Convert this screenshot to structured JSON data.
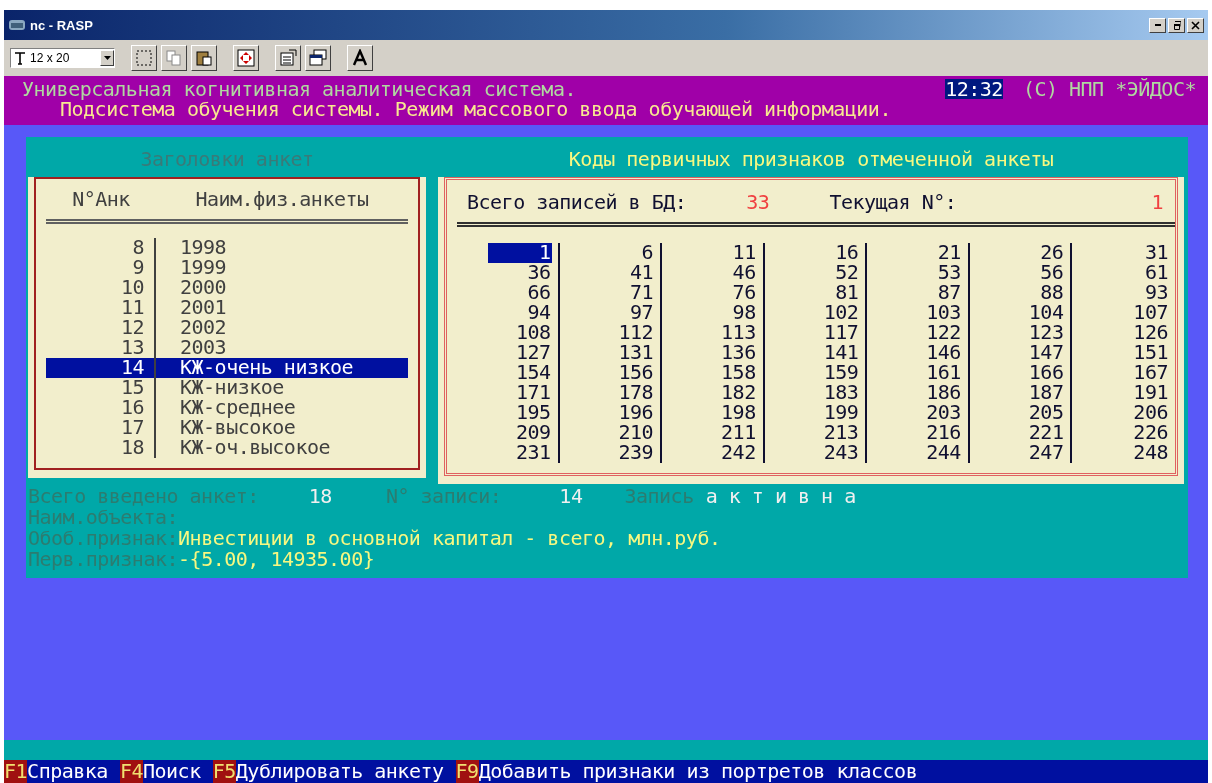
{
  "window": {
    "title": "nc - RASP"
  },
  "toolbar": {
    "font_size": "12 x 20"
  },
  "header": {
    "line1": "Универсальная когнитивная аналитическая система.",
    "clock": "12:32",
    "copyright": "(C) НПП *ЭЙДОС*",
    "line2": "Подсистема обучения системы. Режим массового ввода обучающей информации."
  },
  "left_panel": {
    "title": "Заголовки анкет",
    "active": false,
    "columns": [
      "N°Анк",
      "Наим.физ.анкеты"
    ],
    "rows": [
      {
        "number": "8",
        "name": "1998",
        "selected": false
      },
      {
        "number": "9",
        "name": "1999",
        "selected": false
      },
      {
        "number": "10",
        "name": "2000",
        "selected": false
      },
      {
        "number": "11",
        "name": "2001",
        "selected": false
      },
      {
        "number": "12",
        "name": "2002",
        "selected": false
      },
      {
        "number": "13",
        "name": "2003",
        "selected": false
      },
      {
        "number": "14",
        "name": "КЖ-очень низкое",
        "selected": true
      },
      {
        "number": "15",
        "name": "КЖ-низкое",
        "selected": false
      },
      {
        "number": "16",
        "name": "КЖ-среднее",
        "selected": false
      },
      {
        "number": "17",
        "name": "КЖ-высокое",
        "selected": false
      },
      {
        "number": "18",
        "name": "КЖ-оч.высокое",
        "selected": false
      }
    ]
  },
  "right_panel": {
    "title": "Коды первичных признаков отмеченной анкеты",
    "active": true,
    "total_label": "Всего записей в БД:",
    "total": "33",
    "current_label": "Текущая N°:",
    "current": "1",
    "rows": [
      [
        {
          "value": "1",
          "selected": true
        },
        {
          "value": "6",
          "selected": false
        },
        {
          "value": "11",
          "selected": false
        },
        {
          "value": "16",
          "selected": false
        },
        {
          "value": "21",
          "selected": false
        },
        {
          "value": "26",
          "selected": false
        },
        {
          "value": "31",
          "selected": false
        }
      ],
      [
        {
          "value": "36",
          "selected": false
        },
        {
          "value": "41",
          "selected": false
        },
        {
          "value": "46",
          "selected": false
        },
        {
          "value": "52",
          "selected": false
        },
        {
          "value": "53",
          "selected": false
        },
        {
          "value": "56",
          "selected": false
        },
        {
          "value": "61",
          "selected": false
        }
      ],
      [
        {
          "value": "66",
          "selected": false
        },
        {
          "value": "71",
          "selected": false
        },
        {
          "value": "76",
          "selected": false
        },
        {
          "value": "81",
          "selected": false
        },
        {
          "value": "87",
          "selected": false
        },
        {
          "value": "88",
          "selected": false
        },
        {
          "value": "93",
          "selected": false
        }
      ],
      [
        {
          "value": "94",
          "selected": false
        },
        {
          "value": "97",
          "selected": false
        },
        {
          "value": "98",
          "selected": false
        },
        {
          "value": "102",
          "selected": false
        },
        {
          "value": "103",
          "selected": false
        },
        {
          "value": "104",
          "selected": false
        },
        {
          "value": "107",
          "selected": false
        }
      ],
      [
        {
          "value": "108",
          "selected": false
        },
        {
          "value": "112",
          "selected": false
        },
        {
          "value": "113",
          "selected": false
        },
        {
          "value": "117",
          "selected": false
        },
        {
          "value": "122",
          "selected": false
        },
        {
          "value": "123",
          "selected": false
        },
        {
          "value": "126",
          "selected": false
        }
      ],
      [
        {
          "value": "127",
          "selected": false
        },
        {
          "value": "131",
          "selected": false
        },
        {
          "value": "136",
          "selected": false
        },
        {
          "value": "141",
          "selected": false
        },
        {
          "value": "146",
          "selected": false
        },
        {
          "value": "147",
          "selected": false
        },
        {
          "value": "151",
          "selected": false
        }
      ],
      [
        {
          "value": "154",
          "selected": false
        },
        {
          "value": "156",
          "selected": false
        },
        {
          "value": "158",
          "selected": false
        },
        {
          "value": "159",
          "selected": false
        },
        {
          "value": "161",
          "selected": false
        },
        {
          "value": "166",
          "selected": false
        },
        {
          "value": "167",
          "selected": false
        }
      ],
      [
        {
          "value": "171",
          "selected": false
        },
        {
          "value": "178",
          "selected": false
        },
        {
          "value": "182",
          "selected": false
        },
        {
          "value": "183",
          "selected": false
        },
        {
          "value": "186",
          "selected": false
        },
        {
          "value": "187",
          "selected": false
        },
        {
          "value": "191",
          "selected": false
        }
      ],
      [
        {
          "value": "195",
          "selected": false
        },
        {
          "value": "196",
          "selected": false
        },
        {
          "value": "198",
          "selected": false
        },
        {
          "value": "199",
          "selected": false
        },
        {
          "value": "203",
          "selected": false
        },
        {
          "value": "205",
          "selected": false
        },
        {
          "value": "206",
          "selected": false
        }
      ],
      [
        {
          "value": "209",
          "selected": false
        },
        {
          "value": "210",
          "selected": false
        },
        {
          "value": "211",
          "selected": false
        },
        {
          "value": "213",
          "selected": false
        },
        {
          "value": "216",
          "selected": false
        },
        {
          "value": "221",
          "selected": false
        },
        {
          "value": "226",
          "selected": false
        }
      ],
      [
        {
          "value": "231",
          "selected": false
        },
        {
          "value": "239",
          "selected": false
        },
        {
          "value": "242",
          "selected": false
        },
        {
          "value": "243",
          "selected": false
        },
        {
          "value": "244",
          "selected": false
        },
        {
          "value": "247",
          "selected": false
        },
        {
          "value": "248",
          "selected": false
        }
      ]
    ]
  },
  "status": {
    "entered_label": "Всего введено анкет:",
    "entered": "18",
    "record_label": "N° записи:",
    "record": "14",
    "record_state_label": "Запись",
    "record_state": "а к т и в н а",
    "object_label": "Наим.объекта:",
    "feature_label": "Обоб.признак:",
    "feature_value": "Инвестиции в основной капитал - всего, млн.руб.",
    "primary_label": "Перв.признак:",
    "primary_value": "-{5.00, 14935.00}"
  },
  "function_keys": [
    {
      "key": "F1",
      "label": "Справка"
    },
    {
      "key": "F4",
      "label": "Поиск"
    },
    {
      "key": "F5",
      "label": "Дублировать анкету"
    },
    {
      "key": "F9",
      "label": "Добавить признаки из портретов классов"
    }
  ]
}
